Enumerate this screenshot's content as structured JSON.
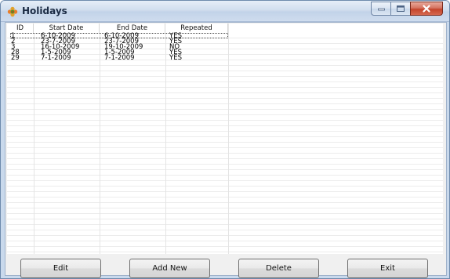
{
  "window": {
    "title": "Holidays",
    "icon": "holiday-flower-icon",
    "controls": {
      "minimize_icon": "minimize-icon",
      "maximize_icon": "maximize-icon",
      "close_icon": "close-icon"
    }
  },
  "table": {
    "columns": [
      "ID",
      "Start Date",
      "End Date",
      "Repeated"
    ],
    "rows": [
      [
        "1",
        "6-10-2009",
        "6-10-2009",
        "YES"
      ],
      [
        "2",
        "23-7-2009",
        "23-7-2009",
        "YES"
      ],
      [
        "3",
        "16-10-2009",
        "19-10-2009",
        "NO"
      ],
      [
        "28",
        "1-5-2009",
        "1-5-2009",
        "YES"
      ],
      [
        "29",
        "7-1-2009",
        "7-1-2009",
        "YES"
      ]
    ]
  },
  "buttons": {
    "edit": "Edit",
    "add_new": "Add New",
    "delete": "Delete",
    "exit": "Exit"
  }
}
